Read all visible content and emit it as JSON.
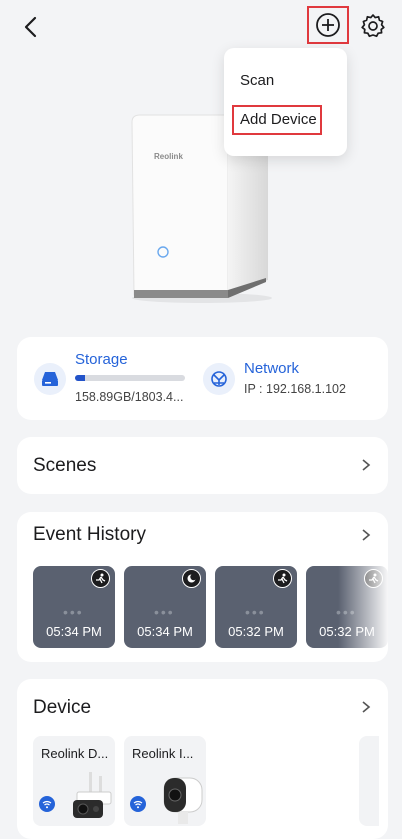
{
  "header": {
    "back_icon": "chevron-left-icon",
    "add_icon": "plus-circle-icon",
    "settings_icon": "gear-icon"
  },
  "dropdown": {
    "items": [
      {
        "label": "Scan"
      },
      {
        "label": "Add Device"
      }
    ]
  },
  "hub": {
    "brand": "Reolink"
  },
  "storage": {
    "label": "Storage",
    "usage": "158.89GB/1803.4...",
    "used_fraction": 0.088
  },
  "network": {
    "label": "Network",
    "ip": "IP : 192.168.1.102"
  },
  "scenes": {
    "title": "Scenes"
  },
  "event_history": {
    "title": "Event History",
    "events": [
      {
        "time": "05:34 PM",
        "badge": "motion-person-icon"
      },
      {
        "time": "05:34 PM",
        "badge": "night-mode-icon"
      },
      {
        "time": "05:32 PM",
        "badge": "motion-person-icon"
      },
      {
        "time": "05:32 PM",
        "badge": "motion-person-icon"
      }
    ]
  },
  "devices": {
    "title": "Device",
    "items": [
      {
        "name": "Reolink D...",
        "icon": "wifi-icon"
      },
      {
        "name": "Reolink I...",
        "icon": "wifi-icon"
      }
    ]
  },
  "colors": {
    "accent": "#2563d9",
    "highlight": "#e0393e",
    "thumb": "#5a6170",
    "background": "#f3f4f6"
  }
}
